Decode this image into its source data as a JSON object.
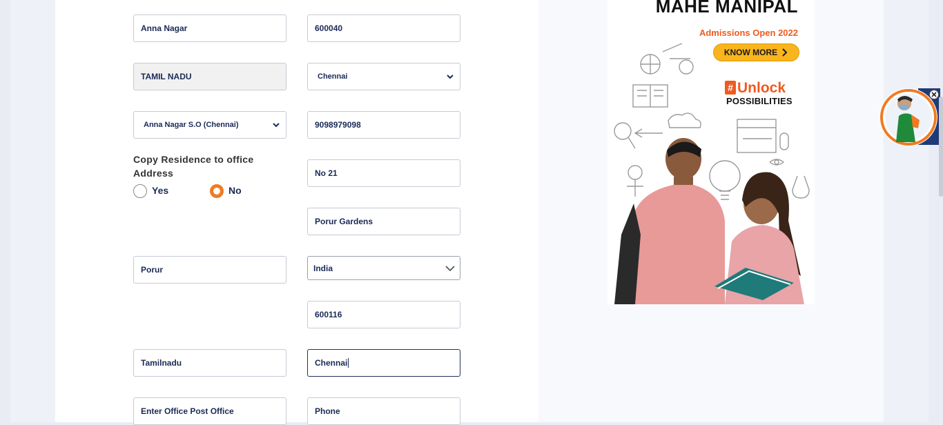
{
  "residence": {
    "area": "Anna Nagar",
    "pincode": "600040",
    "state": "TAMIL NADU",
    "district": "Chennai",
    "post_office": "Anna Nagar S.O (Chennai)",
    "mobile": "9098979098"
  },
  "copy_address": {
    "label": "Copy Residence to office Address",
    "options": [
      {
        "label": "Yes",
        "selected": false
      },
      {
        "label": "No",
        "selected": true
      }
    ]
  },
  "office": {
    "address_line1": "No 21",
    "address_line2": "Porur Gardens",
    "area": "Porur",
    "country": "India",
    "pincode": "600116",
    "state": "Tamilnadu",
    "city": "Chennai",
    "post_office_placeholder": "Enter Office Post Office",
    "phone_placeholder": "Phone"
  },
  "ad": {
    "title": "MAHE MANIPAL",
    "admissions": "Admissions Open 2022",
    "cta": "KNOW MORE",
    "unlock_hash": "#",
    "unlock": "Unlock",
    "possibilities": "POSSIBILITIES"
  },
  "colors": {
    "accent": "#f07b22",
    "text": "#1a2a55",
    "ad_orange": "#f05a1e",
    "ad_button": "#f8b51c"
  },
  "icons": [
    "chevron-down-icon",
    "close-icon",
    "radio-icon",
    "chevron-right-icon"
  ]
}
